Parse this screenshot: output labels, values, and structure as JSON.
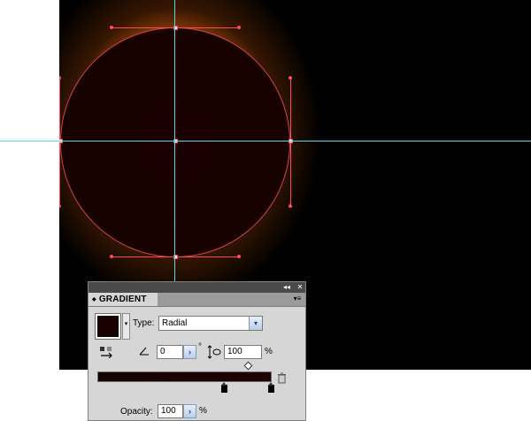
{
  "gradient_panel": {
    "collapse_glyph": "◂◂",
    "close_glyph": "✕",
    "tab_title": "GRADIENT",
    "tab_arrow": "◆",
    "menu_glyph": "▾≡",
    "swatch_dropdown_glyph": "▾",
    "type_label": "Type:",
    "type_value": "Radial",
    "type_arrow": "▾",
    "angle_value": "0",
    "degree_symbol": "°",
    "aspect_value": "100",
    "aspect_unit": "%",
    "spin_glyph": "›",
    "opacity_label": "Opacity:",
    "opacity_value": "100",
    "opacity_unit": "%",
    "trash_glyph": "🗑"
  },
  "colors": {
    "canvas": "#000000",
    "guide": "#56d8e6",
    "selection": "#ff4a5a",
    "glow": "#e66e0a"
  }
}
